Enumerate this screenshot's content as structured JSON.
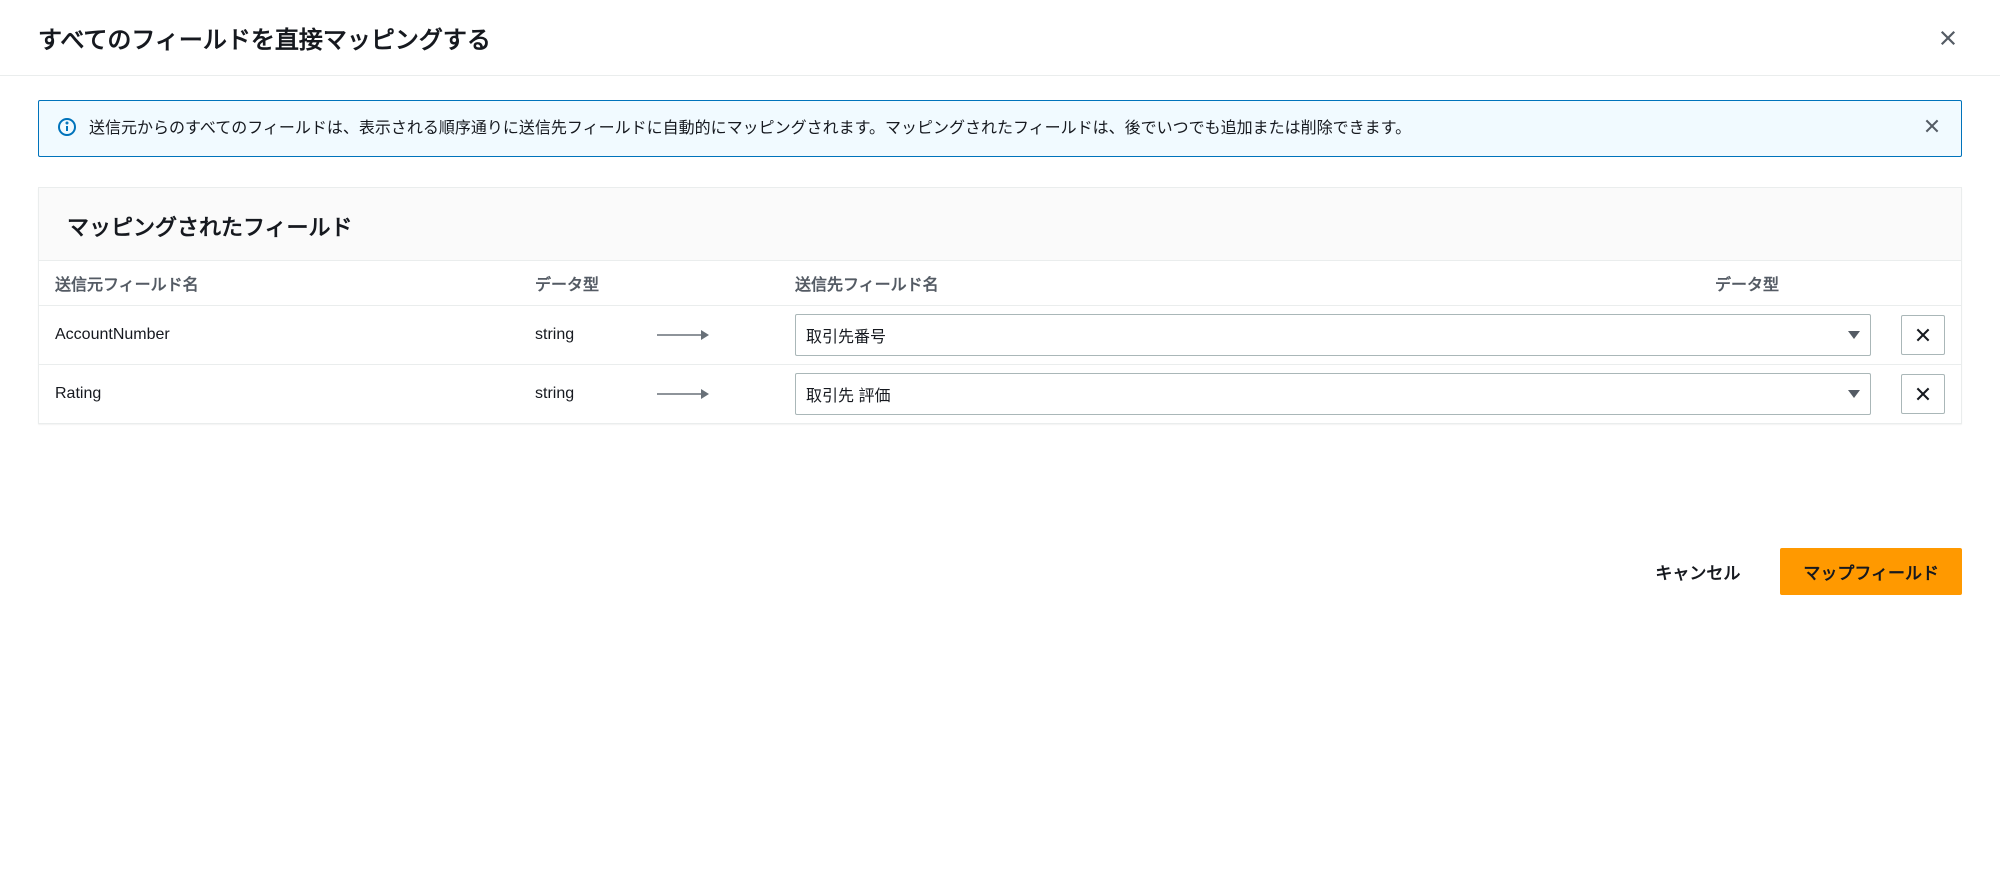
{
  "dialog": {
    "title": "すべてのフィールドを直接マッピングする"
  },
  "info": {
    "message": "送信元からのすべてのフィールドは、表示される順序通りに送信先フィールドに自動的にマッピングされます。マッピングされたフィールドは、後でいつでも追加または削除できます。"
  },
  "panel": {
    "title": "マッピングされたフィールド"
  },
  "table": {
    "headers": {
      "src_name": "送信元フィールド名",
      "src_type": "データ型",
      "dst_name": "送信先フィールド名",
      "dst_type": "データ型"
    },
    "rows": [
      {
        "src_name": "AccountNumber",
        "src_type": "string",
        "dst_value": "取引先番号"
      },
      {
        "src_name": "Rating",
        "src_type": "string",
        "dst_value": "取引先 評価"
      }
    ]
  },
  "footer": {
    "cancel": "キャンセル",
    "submit": "マップフィールド"
  }
}
